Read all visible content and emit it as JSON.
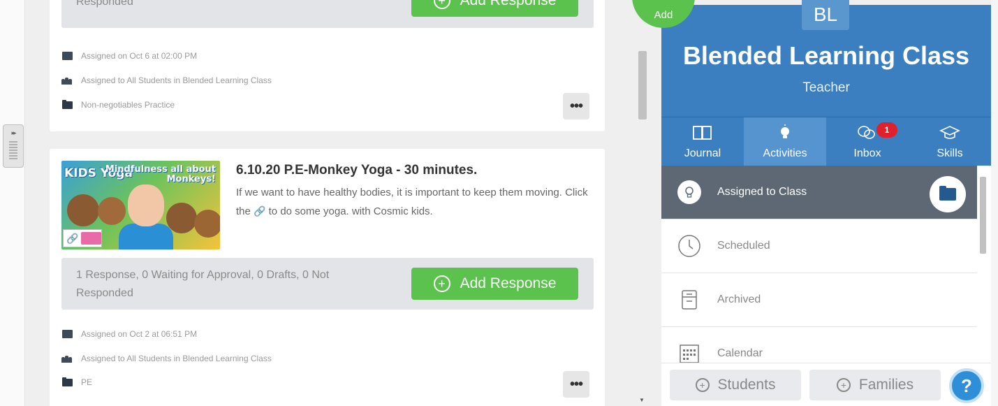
{
  "feed": {
    "card1": {
      "response_status": "Responded",
      "add_response_label": "Add Response",
      "assigned_on": "Assigned on Oct 6 at 02:00 PM",
      "assigned_to": "Assigned to All Students in Blended Learning Class",
      "folder": "Non-negotiables Practice",
      "more_label": "•••"
    },
    "card2": {
      "thumb_text_left": "KIDS Yoga",
      "thumb_text_right": "Mindfulness all about Monkeys!",
      "title": "6.10.20 P.E-Monkey Yoga - 30 minutes.",
      "desc_before_link": "If we want to have healthy bodies, it is important to keep them moving. Click the ",
      "desc_after_link": " to do some yoga. with Cosmic kids.",
      "response_status": "1 Response, 0 Waiting for Approval, 0 Drafts, 0 Not Responded",
      "add_response_label": "Add Response",
      "assigned_on": "Assigned on Oct 2 at 06:51 PM",
      "assigned_to": "Assigned to All Students in Blended Learning Class",
      "folder": "PE",
      "more_label": "•••"
    }
  },
  "fab": {
    "label": "Add"
  },
  "panel": {
    "avatar_initials": "BL",
    "class_name": "Blended Learning Class",
    "role": "Teacher",
    "tabs": [
      {
        "label": "Journal",
        "icon": "book-icon"
      },
      {
        "label": "Activities",
        "icon": "lightbulb-icon",
        "active": true
      },
      {
        "label": "Inbox",
        "icon": "chat-icon",
        "badge": "1"
      },
      {
        "label": "Skills",
        "icon": "graduation-cap-icon"
      }
    ],
    "menu": [
      {
        "label": "Assigned to Class",
        "icon": "lightbulb-icon",
        "active": true
      },
      {
        "label": "Scheduled",
        "icon": "clock-icon"
      },
      {
        "label": "Archived",
        "icon": "archive-icon"
      },
      {
        "label": "Calendar",
        "icon": "calendar-icon"
      }
    ],
    "footer": {
      "students_label": "Students",
      "families_label": "Families",
      "help_label": "?"
    }
  },
  "colors": {
    "brand_blue": "#3b7fc0",
    "active_tab": "#5594cf",
    "green": "#5cc24e",
    "badge_red": "#e0202a",
    "menu_active": "#5d6874"
  }
}
